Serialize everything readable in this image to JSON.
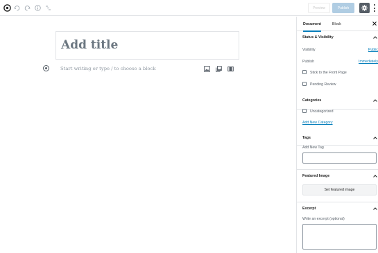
{
  "toolbar": {
    "preview_label": "Preview",
    "publish_label": "Publish"
  },
  "editor": {
    "title_placeholder": "Add title",
    "block_placeholder": "Start writing or type / to choose a block"
  },
  "sidebar": {
    "tabs": [
      {
        "label": "Document",
        "active": true
      },
      {
        "label": "Block",
        "active": false
      }
    ],
    "status_visibility": {
      "heading": "Status & Visibility",
      "visibility_label": "Visibility",
      "visibility_value": "Public",
      "publish_label": "Publish",
      "publish_value": "Immediately",
      "stick_label": "Stick to the Front Page",
      "pending_label": "Pending Review"
    },
    "categories": {
      "heading": "Categories",
      "items": [
        {
          "label": "Uncategorized",
          "checked": false
        }
      ],
      "add_link": "Add New Category"
    },
    "tags": {
      "heading": "Tags",
      "field_label": "Add New Tag",
      "value": ""
    },
    "featured_image": {
      "heading": "Featured Image",
      "button_label": "Set featured image"
    },
    "excerpt": {
      "heading": "Excerpt",
      "field_label": "Write an excerpt (optional)",
      "value": ""
    }
  },
  "colors": {
    "accent": "#007cba",
    "publish_disabled": "#b0cde3",
    "settings_active": "#555d66"
  }
}
